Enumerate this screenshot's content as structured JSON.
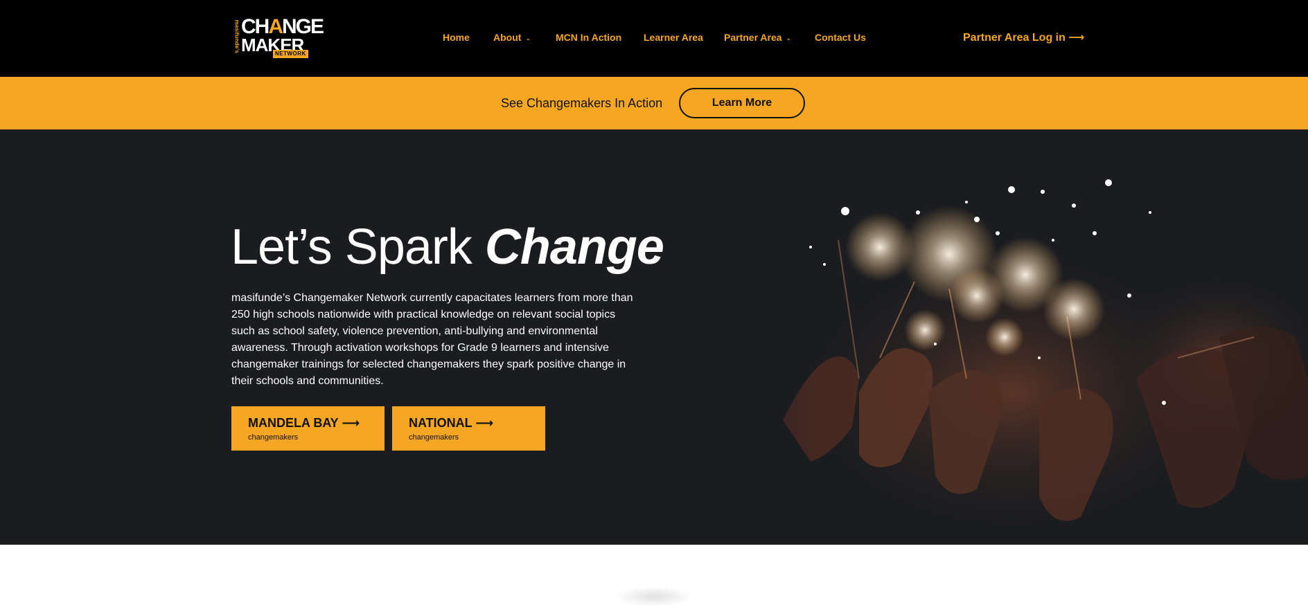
{
  "brand": {
    "tagline": "masifunde's",
    "word1_pre": "CH",
    "word1_a": "A",
    "word1_post": "NGE",
    "word2": "MAKER",
    "word3": "NETWORK",
    "accent_color": "#f5a623"
  },
  "nav": {
    "items": [
      {
        "label": "Home",
        "has_dropdown": false
      },
      {
        "label": "About",
        "has_dropdown": true
      },
      {
        "label": "MCN In Action",
        "has_dropdown": false
      },
      {
        "label": "Learner Area",
        "has_dropdown": false
      },
      {
        "label": "Partner Area",
        "has_dropdown": true
      },
      {
        "label": "Contact Us",
        "has_dropdown": false
      }
    ],
    "dropdown_glyph": "⌄",
    "partner_login": "Partner Area Log in ⟶"
  },
  "promo": {
    "text": "See Changemakers In Action",
    "button": "Learn More"
  },
  "hero": {
    "title_plain": "Let’s Spark ",
    "title_emphasis": "Change",
    "body": "masifunde’s Changemaker Network currently capacitates learners from more than 250 high schools nationwide with practical knowledge on relevant social topics such as school safety, violence prevention, anti-bullying and environmental awareness. Through activation workshops for Grade 9 learners and intensive changemaker trainings for selected changemakers they spark positive change in their schools and communities.",
    "image": "sparklers-photo",
    "ctas": [
      {
        "title": "MANDELA BAY ⟶",
        "subtitle": "changemakers"
      },
      {
        "title": "NATIONAL ⟶",
        "subtitle": "changemakers"
      }
    ]
  },
  "colors": {
    "header_bg": "#000000",
    "promo_bg": "#f5a623",
    "hero_bg": "#1a1c1f",
    "text_dark": "#111111"
  }
}
